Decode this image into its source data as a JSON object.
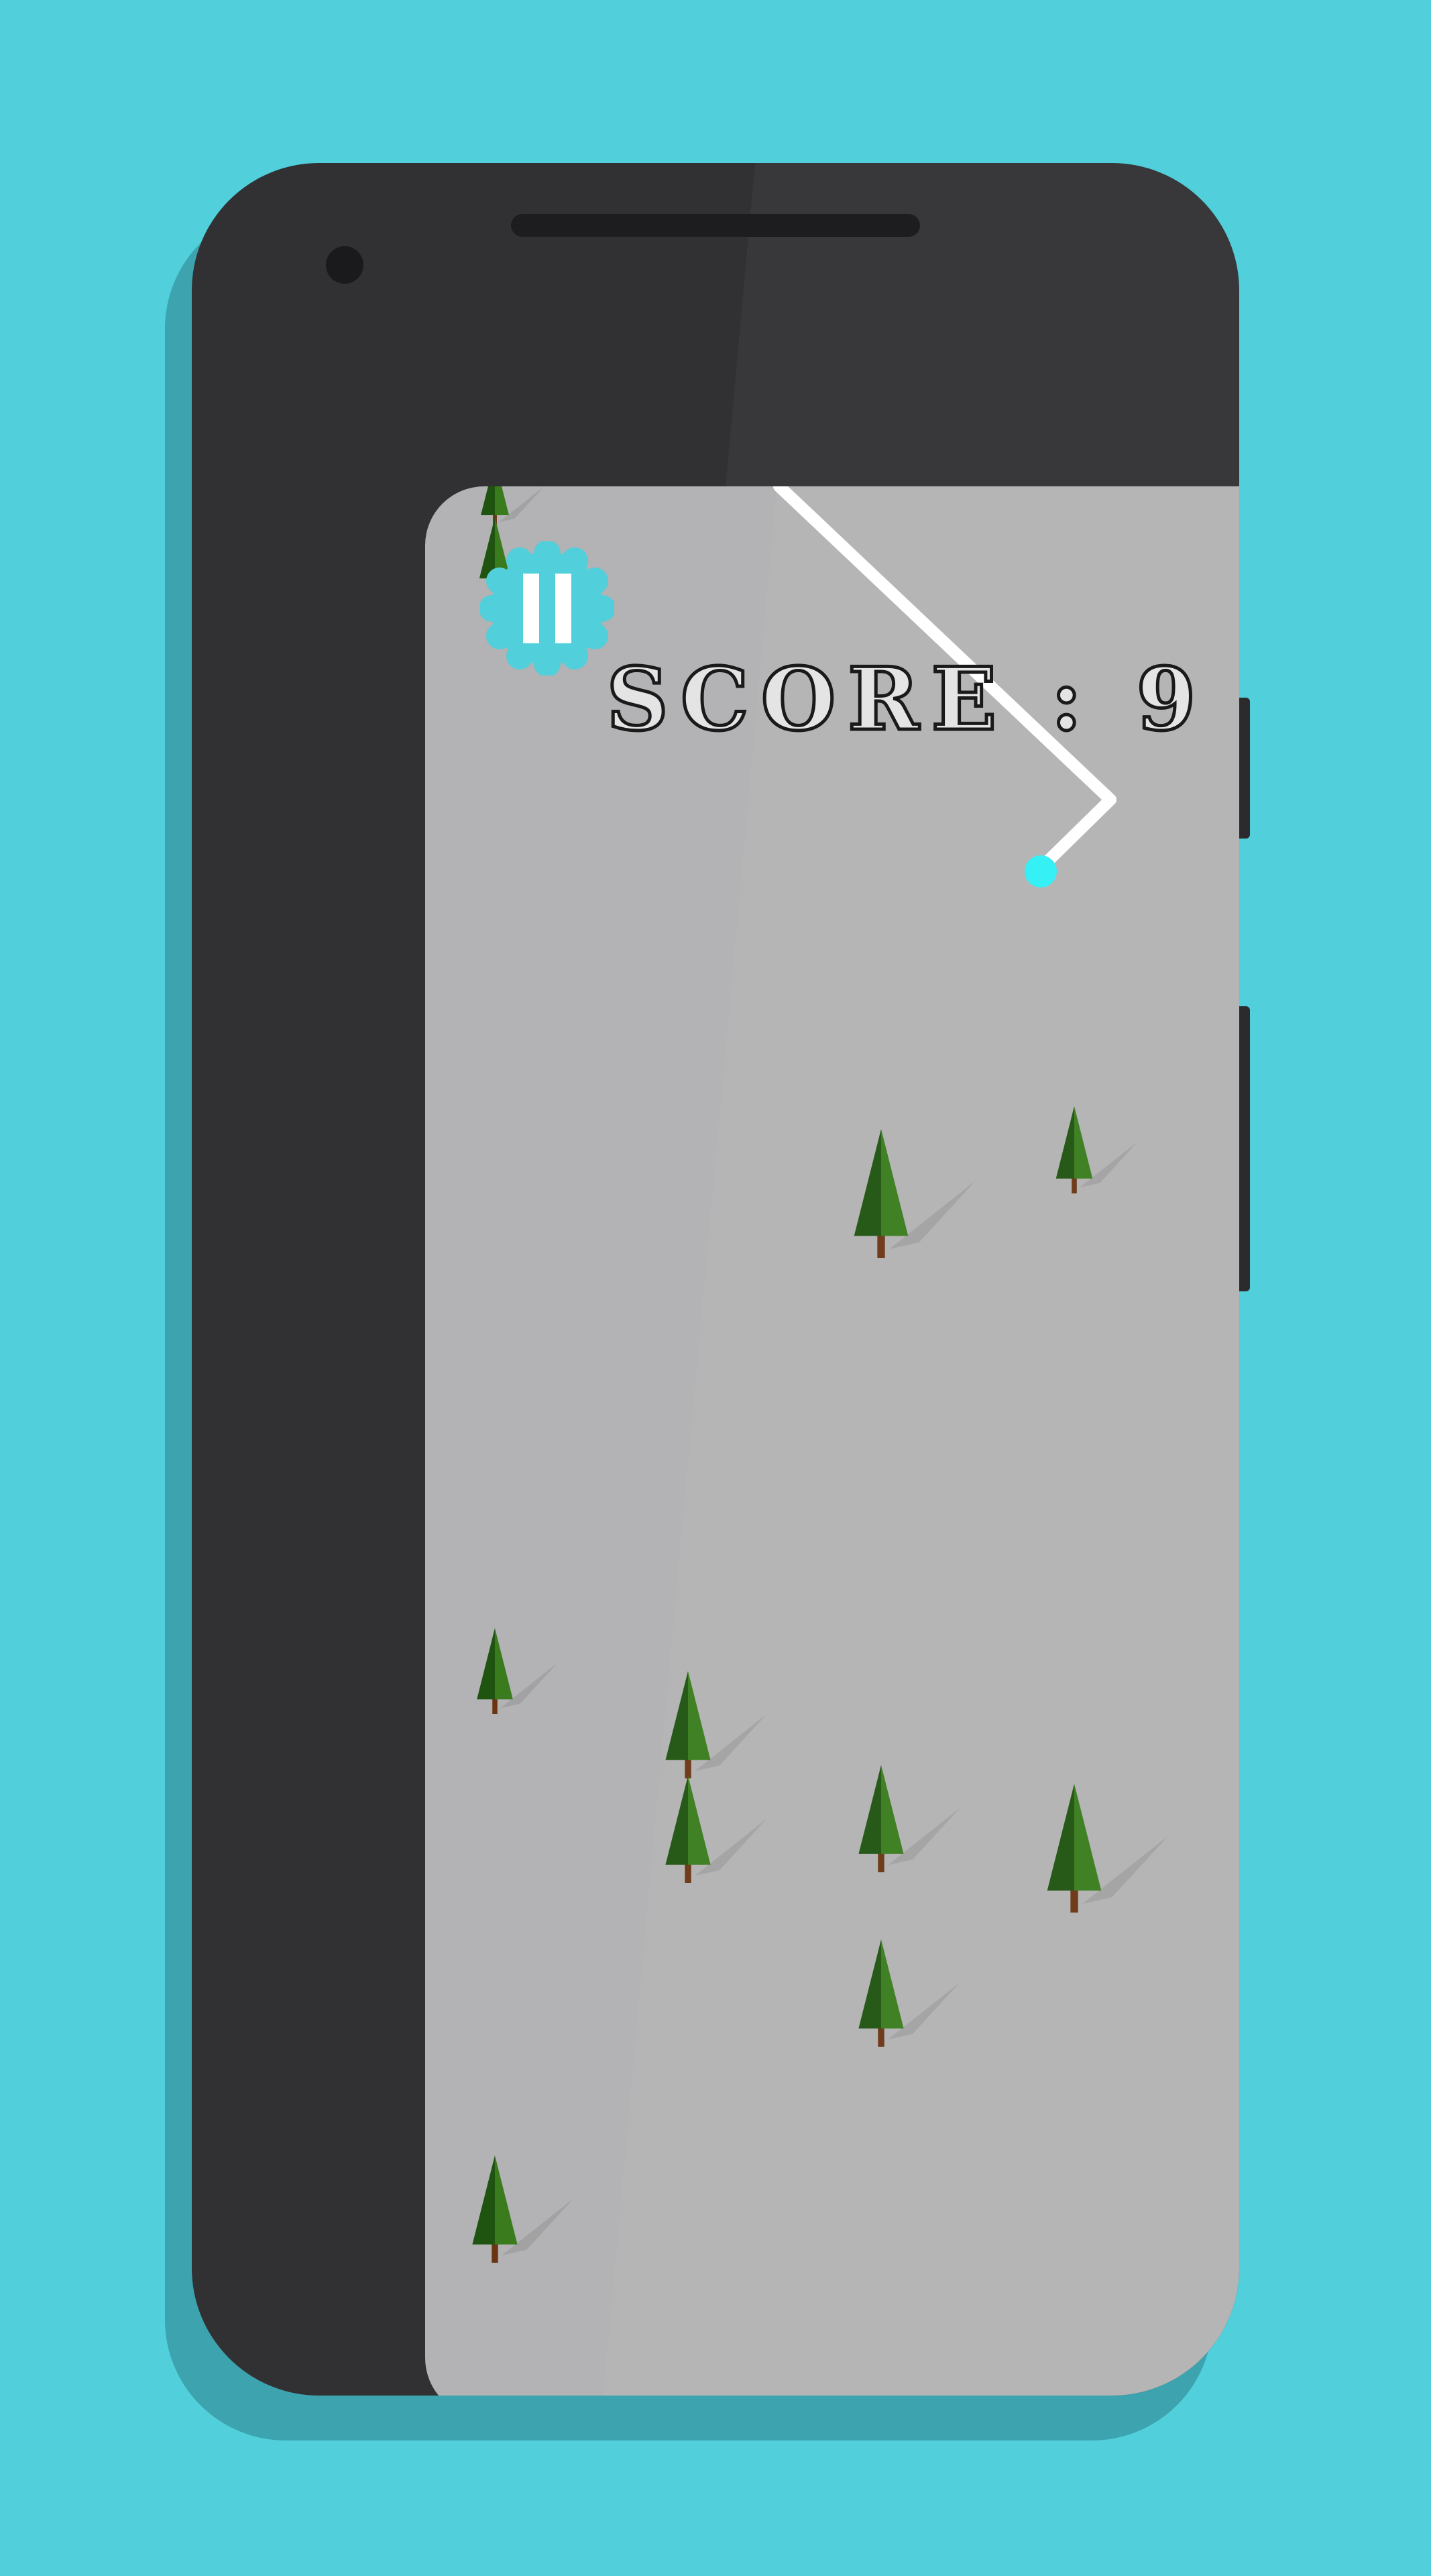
{
  "score": {
    "label": "SCORE",
    "separator": ":",
    "value": "9"
  },
  "pause_button": {
    "icon": "pause-icon"
  },
  "colors": {
    "background": "#51cfda",
    "phone_body": "#313033",
    "snow": "#b3b2b4",
    "trail": "#ffffff",
    "skier": "#2df0f4",
    "pause_badge": "#51cfda",
    "tree_dark": "#1f5410",
    "tree_light": "#3a7c1d",
    "trunk": "#6b3513"
  }
}
